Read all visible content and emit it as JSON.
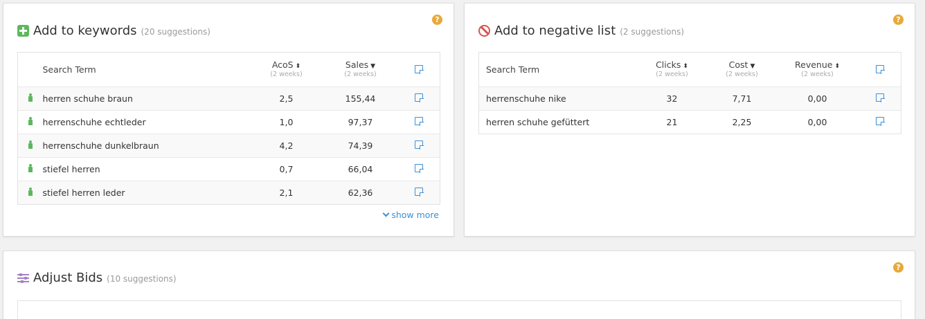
{
  "add_keywords": {
    "title": "Add to keywords",
    "count": "(20 suggestions)",
    "help": "?",
    "columns": {
      "term": "Search Term",
      "acos": "AcoS",
      "sales": "Sales",
      "period": "(2 weeks)"
    },
    "rows": [
      {
        "term": "herren schuhe braun",
        "acos": "2,5",
        "sales": "155,44"
      },
      {
        "term": "herrenschuhe echtleder",
        "acos": "1,0",
        "sales": "97,37"
      },
      {
        "term": "herrenschuhe dunkelbraun",
        "acos": "4,2",
        "sales": "74,39"
      },
      {
        "term": "stiefel herren",
        "acos": "0,7",
        "sales": "66,04"
      },
      {
        "term": "stiefel herren leder",
        "acos": "2,1",
        "sales": "62,36"
      }
    ],
    "show_more": "show more"
  },
  "add_negative": {
    "title": "Add to negative list",
    "count": "(2 suggestions)",
    "help": "?",
    "columns": {
      "term": "Search Term",
      "clicks": "Clicks",
      "cost": "Cost",
      "revenue": "Revenue",
      "period": "(2 weeks)"
    },
    "rows": [
      {
        "term": "herrenschuhe nike",
        "clicks": "32",
        "cost": "7,71",
        "revenue": "0,00"
      },
      {
        "term": "herren schuhe gefüttert",
        "clicks": "21",
        "cost": "2,25",
        "revenue": "0,00"
      }
    ]
  },
  "adjust_bids": {
    "title": "Adjust Bids",
    "count": "(10 suggestions)",
    "help": "?"
  },
  "colors": {
    "accent_green": "#5cb85c",
    "accent_red": "#d9534f",
    "accent_purple": "#a57fc4",
    "link_blue": "#3a8fd6",
    "help_orange": "#e8a93b"
  },
  "icons": {
    "sort_both": "⬍",
    "sort_down": "▾"
  }
}
